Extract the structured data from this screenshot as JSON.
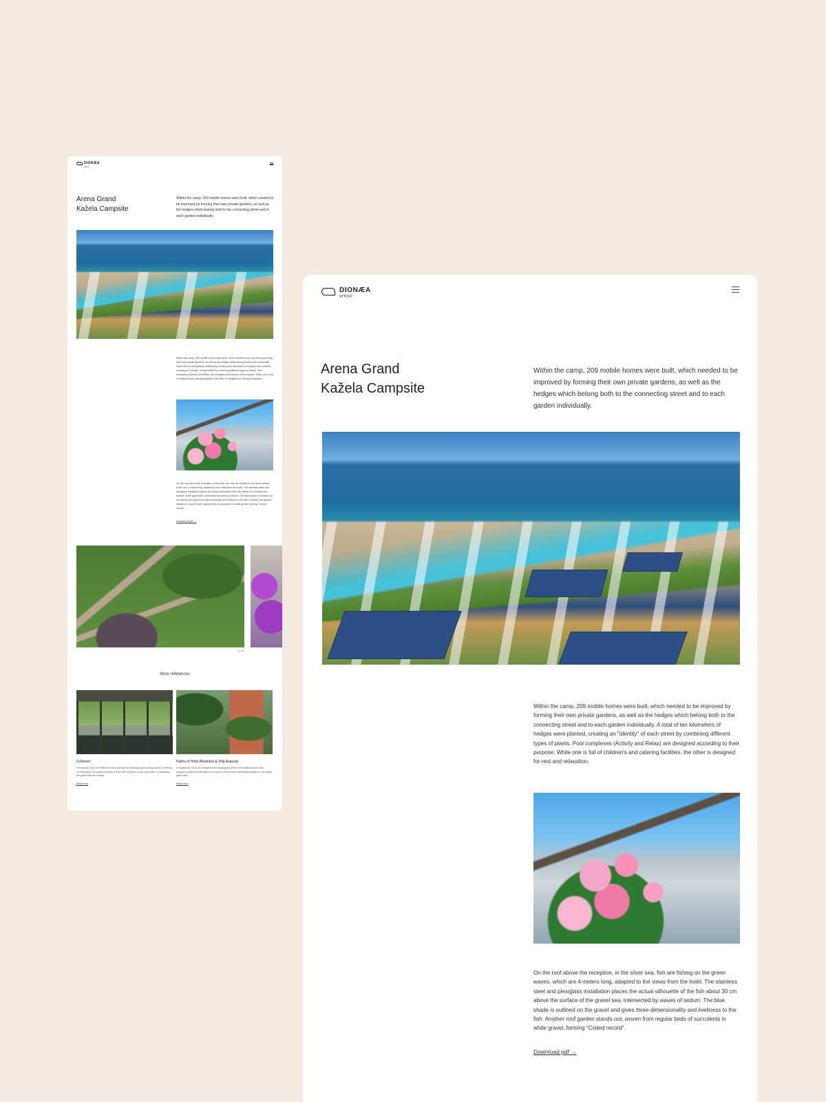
{
  "brand": {
    "name": "DIONÆA",
    "sub": "vrtovi"
  },
  "project": {
    "title_line1": "Arena Grand",
    "title_line2": "Kažela Campsite",
    "intro": "Within the camp, 209 mobile homes were built, which needed to be improved by forming their own private gardens, as well as the hedges which belong both to the connecting street and to each garden individually.",
    "body1": "Within the camp, 209 mobile homes were built, which needed to be improved by forming their own private gardens, as well as the hedges which belong both to the connecting street and to each garden individually. A total of ten kilometers of hedges were planted, creating an \"identity\" of each street by combining different types of plants. Pool complexes (Activity and Relax) are designed according to their purpose. While one is full of children's and catering facilities, the other is designed for rest and relaxation.",
    "body2": "On the roof above the reception, in the silver sea, fish are fishing on the green waves, which are 4 meters long, adapted to the views from the hotel. The stainless steel and plexiglass installation places the actual silhouette of the fish about 30 cm above the surface of the gravel sea, intersected by waves of sedum. The blue shade is outlined on the gravel and gives three-dimensionality and liveliness to the fish. Another roof garden stands out, woven from regular beds of succulents in white gravel, forming \"Coded record\".",
    "download_label": "Download pdf →"
  },
  "gallery": {
    "counter": "01 / 08"
  },
  "more_references": {
    "heading": "More references",
    "items": [
      {
        "title": "O-Resort",
        "text": "In February 2016, we finished a new proposal for landscaping the newly opened O-Resort in Crikvenica. The project includes a hotel with 60 luxury rooms and suites, a restaurant, the yacht club and marina.",
        "link": "Read more"
      },
      {
        "title": "Palms of Hotel Alhambra & Villa Augusta",
        "text": "In September 2015 we completed the landscaping of the Hotel Alhambra and Villa Augusta. A special challenge for us was the preservation and transplantation of old quality palm trees.",
        "link": "Read more"
      }
    ]
  }
}
